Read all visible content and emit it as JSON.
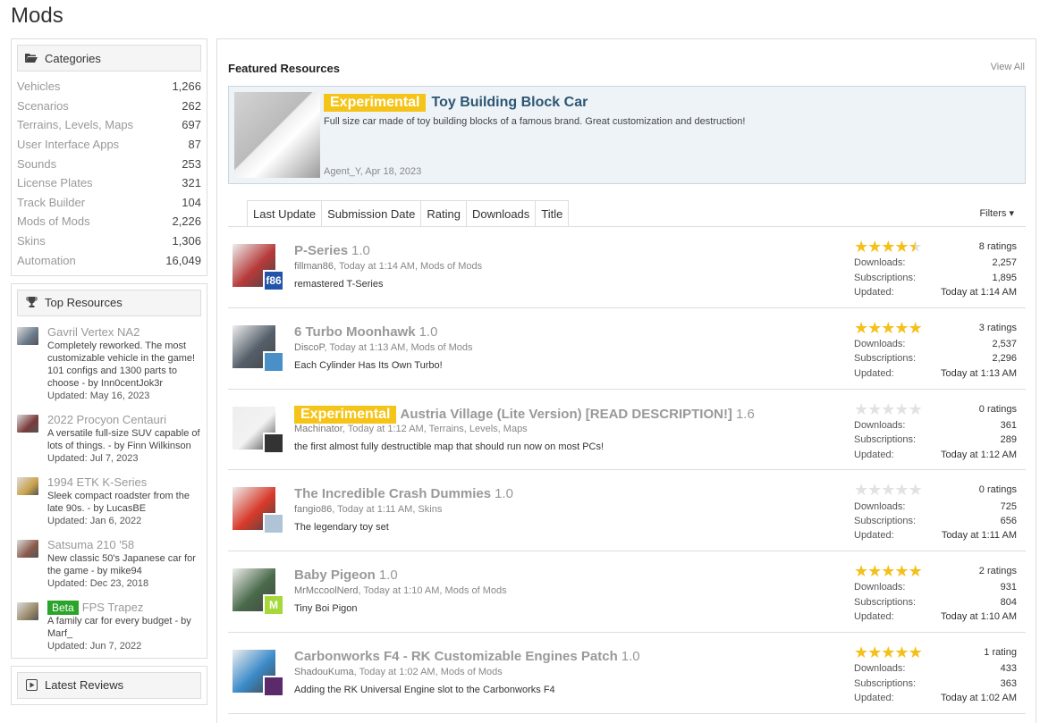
{
  "page": {
    "title": "Mods"
  },
  "sidebar": {
    "categories_title": "Categories",
    "categories": [
      {
        "name": "Vehicles",
        "count": "1,266"
      },
      {
        "name": "Scenarios",
        "count": "262"
      },
      {
        "name": "Terrains, Levels, Maps",
        "count": "697"
      },
      {
        "name": "User Interface Apps",
        "count": "87"
      },
      {
        "name": "Sounds",
        "count": "253"
      },
      {
        "name": "License Plates",
        "count": "321"
      },
      {
        "name": "Track Builder",
        "count": "104"
      },
      {
        "name": "Mods of Mods",
        "count": "2,226"
      },
      {
        "name": "Skins",
        "count": "1,306"
      },
      {
        "name": "Automation",
        "count": "16,049"
      }
    ],
    "top_resources_title": "Top Resources",
    "top_resources": [
      {
        "title": "Gavril Vertex NA2",
        "desc": "Completely reworked. The most customizable vehicle in the game! 101 configs and 1300 parts to choose - by Inn0centJok3r",
        "updated": "Updated: May 16, 2023",
        "color": "#6a7a8a"
      },
      {
        "title": "2022 Procyon Centauri",
        "desc": "A versatile full-size SUV capable of lots of things. - by Finn Wilkinson",
        "updated": "Updated: Jul 7, 2023",
        "color": "#7a3a3a"
      },
      {
        "title": "1994 ETK K-Series",
        "desc": "Sleek compact roadster from the late 90s. - by LucasBE",
        "updated": "Updated: Jan 6, 2022",
        "color": "#c9a24a"
      },
      {
        "title": "Satsuma 210 '58",
        "desc": "New classic 50's Japanese car for the game - by mike94",
        "updated": "Updated: Dec 23, 2018",
        "color": "#8a5a4a"
      },
      {
        "title": "FPS Trapez",
        "badge": "Beta",
        "desc": "A family car for every budget - by Marf_",
        "updated": "Updated: Jun 7, 2022",
        "color": "#9a8a6a"
      }
    ],
    "latest_reviews_title": "Latest Reviews"
  },
  "featured": {
    "heading": "Featured Resources",
    "view_all": "View All",
    "badge": "Experimental",
    "title": "Toy Building Block Car",
    "desc": "Full size car made of toy building blocks of a famous brand. Great customization and destruction!",
    "meta": "Agent_Y, Apr 18, 2023"
  },
  "tabs": [
    "Last Update",
    "Submission Date",
    "Rating",
    "Downloads",
    "Title"
  ],
  "filters_label": "Filters",
  "labels": {
    "downloads": "Downloads:",
    "subscriptions": "Subscriptions:",
    "updated": "Updated:"
  },
  "resources": [
    {
      "title": "P-Series",
      "version": "1.0",
      "author": "fillman86",
      "meta_rest": ", Today at 1:14 AM, Mods of Mods",
      "tagline": "remastered T-Series",
      "rating": 4.5,
      "ratings": "8 ratings",
      "downloads": "2,257",
      "subscriptions": "1,895",
      "updated": "Today at 1:14 AM",
      "thumb_color": "#b73a3a",
      "avatar_color": "#2255aa",
      "avatar_text": "f86"
    },
    {
      "title": "6 Turbo Moonhawk",
      "version": "1.0",
      "author": "DiscoP",
      "meta_rest": ", Today at 1:13 AM, Mods of Mods",
      "tagline": "Each Cylinder Has Its Own Turbo!",
      "rating": 5,
      "ratings": "3 ratings",
      "downloads": "2,537",
      "subscriptions": "2,296",
      "updated": "Today at 1:13 AM",
      "thumb_color": "#555f6a",
      "avatar_color": "#4a90c8",
      "avatar_text": ""
    },
    {
      "title": "Austria Village (Lite Version) [READ DESCRIPTION!]",
      "badge": "Experimental",
      "version": "1.6",
      "author": "Machinator",
      "meta_rest": ", Today at 1:12 AM, Terrains, Levels, Maps",
      "tagline": "the first almost fully destructible map that should run now on most PCs!",
      "rating": 0,
      "ratings": "0 ratings",
      "downloads": "361",
      "subscriptions": "289",
      "updated": "Today at 1:12 AM",
      "thumb_color": "#f2f2f2",
      "avatar_color": "#333333",
      "avatar_text": ""
    },
    {
      "title": "The Incredible Crash Dummies",
      "version": "1.0",
      "author": "fangio86",
      "meta_rest": ", Today at 1:11 AM, Skins",
      "tagline": "The legendary toy set",
      "rating": 0,
      "ratings": "0 ratings",
      "downloads": "725",
      "subscriptions": "656",
      "updated": "Today at 1:11 AM",
      "thumb_color": "#d83a2a",
      "avatar_color": "#b0c4d8",
      "avatar_text": ""
    },
    {
      "title": "Baby Pigeon",
      "version": "1.0",
      "author": "MrMccoolNerd",
      "meta_rest": ", Today at 1:10 AM, Mods of Mods",
      "tagline": "Tiny Boi Pigon",
      "rating": 5,
      "ratings": "2 ratings",
      "downloads": "931",
      "subscriptions": "804",
      "updated": "Today at 1:10 AM",
      "thumb_color": "#4a6a4a",
      "avatar_color": "#a6d83a",
      "avatar_text": "M"
    },
    {
      "title": "Carbonworks F4 - RK Customizable Engines Patch",
      "version": "1.0",
      "author": "ShadouKuma",
      "meta_rest": ", Today at 1:02 AM, Mods of Mods",
      "tagline": "Adding the RK Universal Engine slot to the Carbonworks F4",
      "rating": 5,
      "ratings": "1 rating",
      "downloads": "433",
      "subscriptions": "363",
      "updated": "Today at 1:02 AM",
      "thumb_color": "#3a8ac8",
      "avatar_color": "#5a2a6a",
      "avatar_text": ""
    }
  ]
}
